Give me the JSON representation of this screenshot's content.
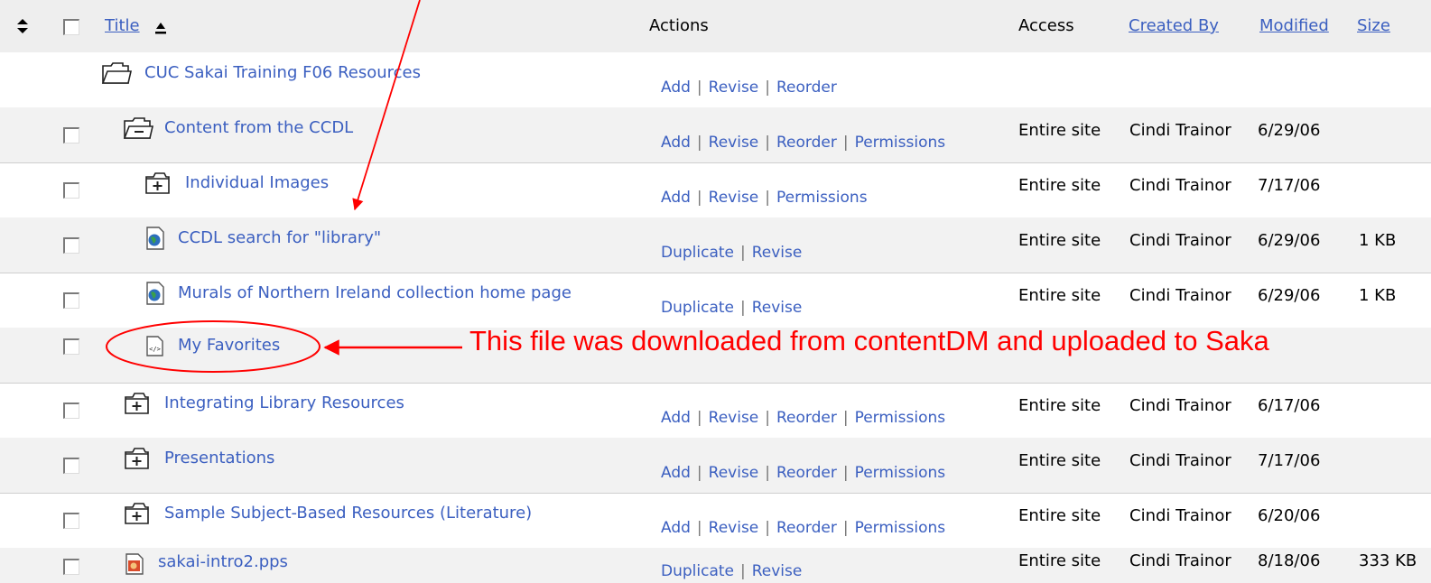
{
  "header": {
    "sort_icon": "updown-arrows-icon",
    "title_label": "Title",
    "title_sort_icon": "sort-ascending-icon",
    "actions_label": "Actions",
    "access_label": "Access",
    "created_by_label": "Created By",
    "modified_label": "Modified",
    "size_label": "Size"
  },
  "rows": [
    {
      "title": "CUC Sakai Training F06 Resources",
      "icon": "folder-open-icon",
      "actions": [
        "Add",
        "Revise",
        "Reorder"
      ],
      "access": "",
      "created_by": "",
      "modified": "",
      "size": ""
    },
    {
      "title": "Content from the CCDL",
      "icon": "folder-open-minus-icon",
      "actions": [
        "Add",
        "Revise",
        "Reorder",
        "Permissions"
      ],
      "access": "Entire site",
      "created_by": "Cindi Trainor",
      "modified": "6/29/06",
      "size": ""
    },
    {
      "title": "Individual Images",
      "icon": "folder-closed-plus-icon",
      "actions": [
        "Add",
        "Revise",
        "Permissions"
      ],
      "access": "Entire site",
      "created_by": "Cindi Trainor",
      "modified": "7/17/06",
      "size": ""
    },
    {
      "title": "CCDL search for \"library\"",
      "icon": "web-link-icon",
      "actions": [
        "Duplicate",
        "Revise"
      ],
      "access": "Entire site",
      "created_by": "Cindi Trainor",
      "modified": "6/29/06",
      "size": "1 KB"
    },
    {
      "title": "Murals of Northern Ireland collection home page",
      "icon": "web-link-icon",
      "actions": [
        "Duplicate",
        "Revise"
      ],
      "access": "Entire site",
      "created_by": "Cindi Trainor",
      "modified": "6/29/06",
      "size": "1 KB"
    },
    {
      "title": "My Favorites",
      "icon": "html-file-icon",
      "actions": [],
      "access": "",
      "created_by": "",
      "modified": "",
      "size": ""
    },
    {
      "title": "Integrating Library Resources",
      "icon": "folder-closed-plus-icon",
      "actions": [
        "Add",
        "Revise",
        "Reorder",
        "Permissions"
      ],
      "access": "Entire site",
      "created_by": "Cindi Trainor",
      "modified": "6/17/06",
      "size": ""
    },
    {
      "title": "Presentations",
      "icon": "folder-closed-plus-icon",
      "actions": [
        "Add",
        "Revise",
        "Reorder",
        "Permissions"
      ],
      "access": "Entire site",
      "created_by": "Cindi Trainor",
      "modified": "7/17/06",
      "size": ""
    },
    {
      "title": "Sample Subject-Based Resources (Literature)",
      "icon": "folder-closed-plus-icon",
      "actions": [
        "Add",
        "Revise",
        "Reorder",
        "Permissions"
      ],
      "access": "Entire site",
      "created_by": "Cindi Trainor",
      "modified": "6/20/06",
      "size": ""
    },
    {
      "title": "sakai-intro2.pps",
      "icon": "powerpoint-file-icon",
      "actions": [
        "Duplicate",
        "Revise"
      ],
      "access": "Entire site",
      "created_by": "Cindi Trainor",
      "modified": "8/18/06",
      "size": "333 KB"
    }
  ],
  "annotation": {
    "text": "This file was downloaded from contentDM and uploaded to Saka",
    "color": "#ff0000"
  },
  "colors": {
    "link": "#3b5fc0",
    "header_bg": "#eeeeee",
    "row_alt_bg": "#f2f2f2"
  }
}
